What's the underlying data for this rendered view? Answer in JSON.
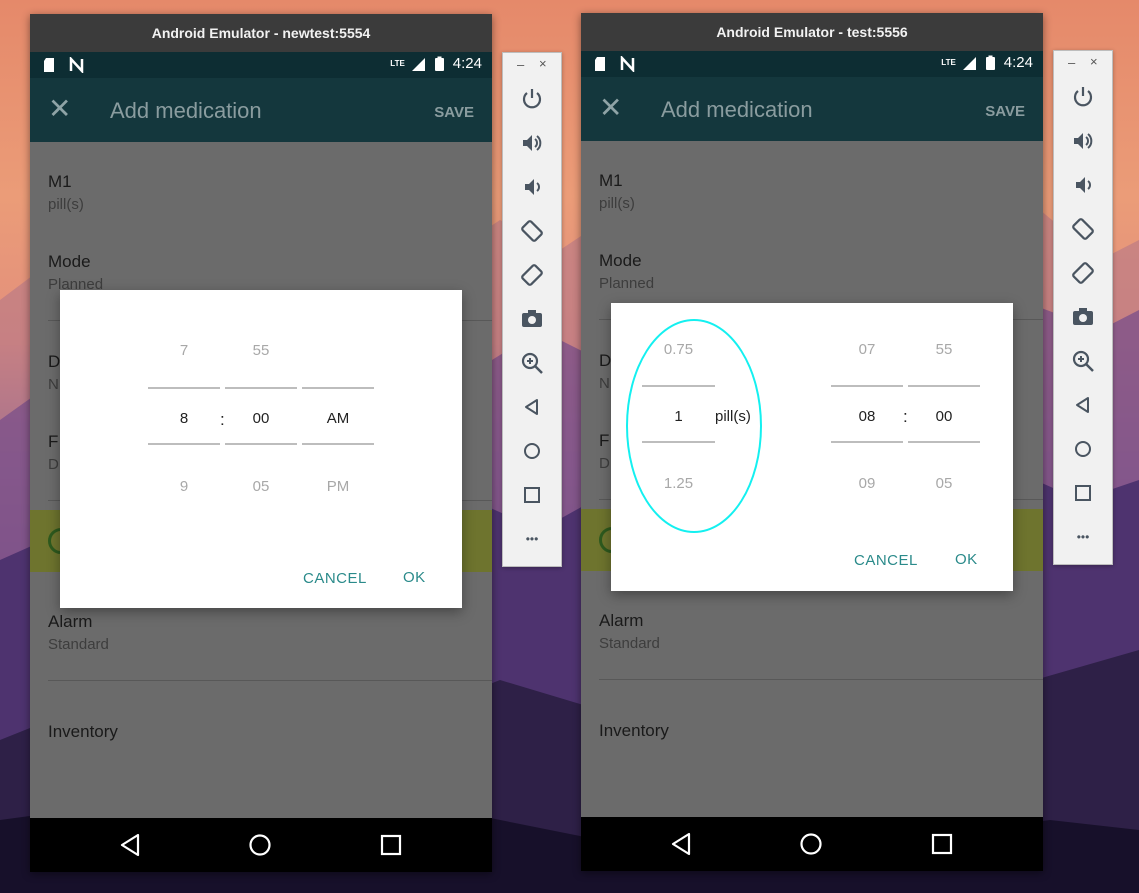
{
  "left": {
    "window_title": "Android Emulator - newtest:5554",
    "status": {
      "network": "LTE",
      "time": "4:24"
    },
    "toolbar": {
      "title": "Add medication",
      "save": "SAVE"
    },
    "rows": {
      "med_name": "M1",
      "med_unit": "pill(s)",
      "mode_title": "Mode",
      "mode_value": "Planned",
      "d_title": "D",
      "d_value": "N",
      "f_title": "F",
      "f_value": "D",
      "alarm_title": "Alarm",
      "alarm_value": "Standard",
      "inventory_title": "Inventory"
    },
    "dialog": {
      "hour": {
        "prev": "7",
        "current": "8",
        "next": "9"
      },
      "minute": {
        "prev": "55",
        "current": "00",
        "next": "05"
      },
      "ampm": {
        "current": "AM",
        "next": "PM"
      },
      "separator": ":",
      "cancel": "CANCEL",
      "ok": "OK"
    }
  },
  "right": {
    "window_title": "Android Emulator - test:5556",
    "status": {
      "network": "LTE",
      "time": "4:24"
    },
    "toolbar": {
      "title": "Add medication",
      "save": "SAVE"
    },
    "rows": {
      "med_name": "M1",
      "med_unit": "pill(s)",
      "mode_title": "Mode",
      "mode_value": "Planned",
      "d_title": "D",
      "d_value": "N",
      "f_title": "F",
      "f_value": "D",
      "alarm_title": "Alarm",
      "alarm_value": "Standard",
      "inventory_title": "Inventory"
    },
    "dialog": {
      "dose": {
        "prev": "0.75",
        "current": "1",
        "next": "1.25"
      },
      "dose_unit": "pill(s)",
      "hour": {
        "prev": "07",
        "current": "08",
        "next": "09"
      },
      "minute": {
        "prev": "55",
        "current": "00",
        "next": "05"
      },
      "separator": ":",
      "cancel": "CANCEL",
      "ok": "OK"
    }
  },
  "side_panel": {
    "minimize": "–",
    "close": "×",
    "buttons": [
      "power-icon",
      "volume-up-icon",
      "volume-down-icon",
      "rotate-left-icon",
      "rotate-right-icon",
      "camera-icon",
      "zoom-icon",
      "back-icon",
      "home-icon",
      "overview-icon",
      "more-icon"
    ],
    "more": "•••"
  },
  "colors": {
    "accent": "#2a8a8a",
    "toolbar": "#14373d",
    "statusbar": "#0d2d33",
    "highlight": "#14f0f0",
    "alarm_bar": "#6e742e"
  }
}
